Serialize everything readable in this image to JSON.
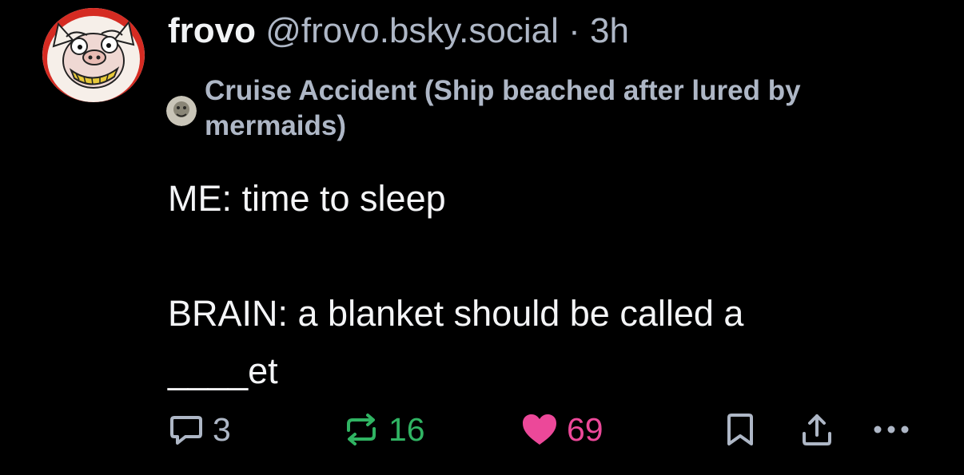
{
  "post": {
    "author_name": "frovo",
    "author_handle": "@frovo.bsky.social",
    "separator": "·",
    "time_ago": "3h",
    "context_label": "Cruise Accident (Ship beached after lured by mermaids)",
    "text_lines": [
      "ME: time to sleep",
      "",
      "BRAIN: a blanket should be called a",
      "____et"
    ]
  },
  "actions": {
    "reply_count": "3",
    "repost_count": "16",
    "like_count": "69",
    "reply_icon": "speech-bubble-icon",
    "repost_icon": "repost-arrows-icon",
    "like_icon": "heart-filled-icon",
    "bookmark_icon": "bookmark-icon",
    "share_icon": "share-upload-icon",
    "more_icon": "ellipsis-icon"
  },
  "colors": {
    "background": "#000000",
    "primary_text": "#f1f3f5",
    "secondary_text": "#aeb7c6",
    "repost": "#30b463",
    "like": "#ec4899",
    "avatar_ring": "#d52b22"
  }
}
